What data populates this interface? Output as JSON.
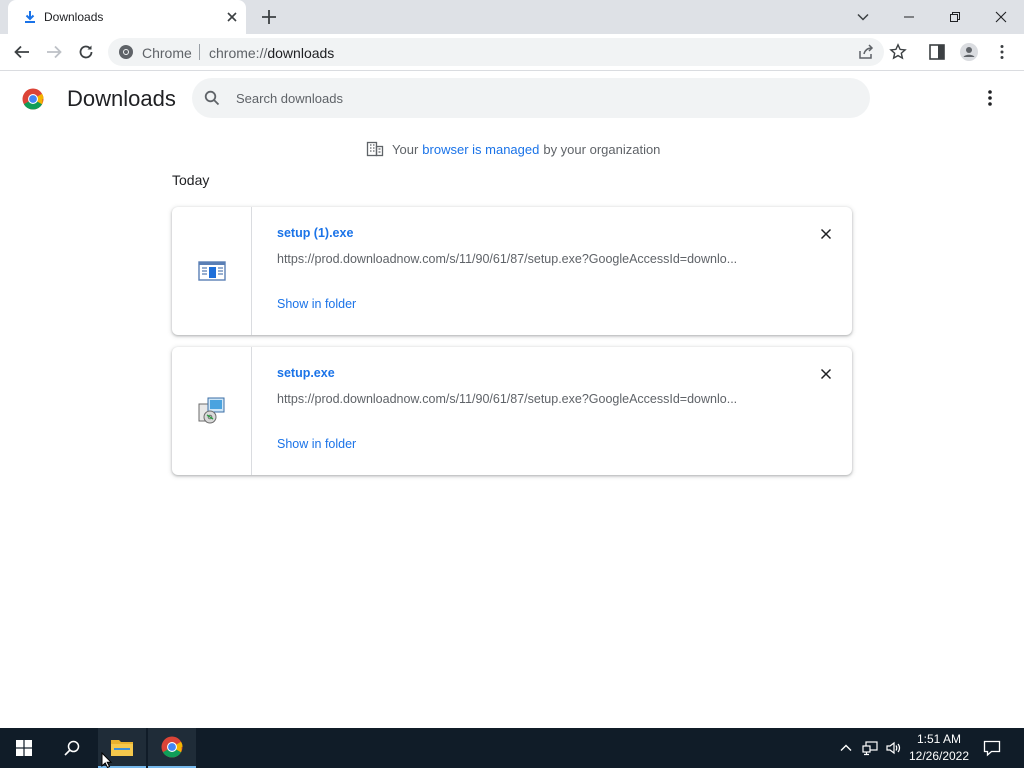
{
  "tab": {
    "title": "Downloads"
  },
  "omnibox": {
    "chip": "Chrome",
    "url_scheme": "chrome://",
    "url_path": "downloads"
  },
  "page": {
    "title": "Downloads",
    "search_placeholder": "Search downloads",
    "managed": {
      "prefix": "Your",
      "link": "browser is managed",
      "suffix": "by your organization"
    },
    "section": "Today"
  },
  "downloads": [
    {
      "name": "setup (1).exe",
      "url": "https://prod.downloadnow.com/s/11/90/61/87/setup.exe?GoogleAccessId=downlo...",
      "action": "Show in folder"
    },
    {
      "name": "setup.exe",
      "url": "https://prod.downloadnow.com/s/11/90/61/87/setup.exe?GoogleAccessId=downlo...",
      "action": "Show in folder"
    }
  ],
  "taskbar": {
    "time": "1:51 AM",
    "date": "12/26/2022"
  },
  "colors": {
    "accent": "#1a73e8",
    "tabstrip": "#dee1e6",
    "taskbar": "#101c28"
  }
}
